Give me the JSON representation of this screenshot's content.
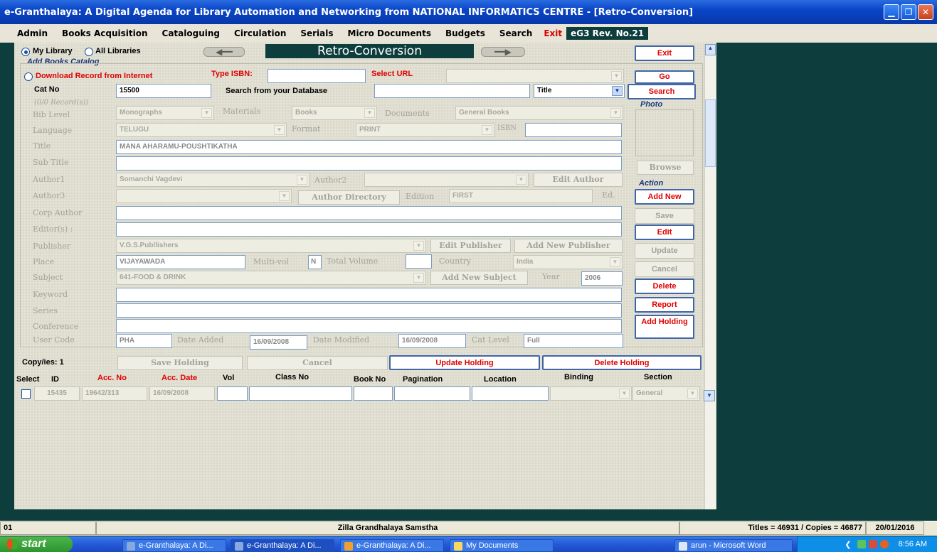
{
  "window": {
    "title": "e-Granthalaya: A Digital Agenda for Library Automation and Networking from NATIONAL INFORMATICS CENTRE - [Retro-Conversion]"
  },
  "menu": {
    "items": [
      "Admin",
      "Books Acquisition",
      "Cataloguing",
      "Circulation",
      "Serials",
      "Micro Documents",
      "Budgets",
      "Search"
    ],
    "exit": "Exit",
    "rev": "eG3 Rev. No.21"
  },
  "header": {
    "my_library": "My Library",
    "all_libraries": "All Libraries",
    "title": "Retro-Conversion",
    "exit": "Exit",
    "add_books": "Add Books Catalog",
    "download": "Download Record from Internet",
    "type_isbn": "Type ISBN:",
    "select_url": "Select URL",
    "go": "Go"
  },
  "form": {
    "cat_no_label": "Cat No",
    "cat_no": "15500",
    "search_db_label": "Search from your Database",
    "search_field": "Title",
    "search_btn": "Search",
    "record_count": "(0/0 Record(s))",
    "photo": "Photo",
    "bib_level_label": "Bib Level",
    "bib_level": "Monographs",
    "materials_label": "Materials",
    "materials": "Books",
    "documents_label": "Documents",
    "documents": "General Books",
    "language_label": "Language",
    "language": "TELUGU",
    "format_label": "Format",
    "format": "PRINT",
    "isbn_label": "ISBN",
    "isbn": "",
    "title_label": "Title",
    "title": "MANA AHARAMU-POUSHTIKATHA",
    "subtitle_label": "Sub Title",
    "subtitle": "",
    "author1_label": "Author1",
    "author1": "Somanchi Vagdevi",
    "author2_label": "Author2",
    "author2": "",
    "edit_author": "Edit Author",
    "browse": "Browse",
    "author3_label": "Author3",
    "author3": "",
    "author_directory": "Author Directory",
    "edition_label": "Edition",
    "edition": "FIRST",
    "ed_label": "Ed.",
    "corp_author_label": "Corp Author",
    "editors_label": "Editor(s) :",
    "publisher_label": "Publisher",
    "publisher": "V.G.S.Publlishers",
    "edit_publisher": "Edit Publisher",
    "add_publisher": "Add New Publisher",
    "place_label": "Place",
    "place": "VIJAYAWADA",
    "multivol_label": "Multi-vol",
    "multivol": "N",
    "total_volume_label": "Total Volume",
    "total_volume": "",
    "country_label": "Country",
    "country": "India",
    "subject_label": "Subject",
    "subject": "641-FOOD & DRINK",
    "add_subject": "Add New Subject",
    "year_label": "Year",
    "year": "2006",
    "keyword_label": "Keyword",
    "series_label": "Series",
    "conference_label": "Conference",
    "user_code_label": "User Code",
    "user_code": "PHA",
    "date_added_label": "Date Added",
    "date_added": "16/09/2008",
    "date_modified_label": "Date Modified",
    "date_modified": "16/09/2008",
    "cat_level_label": "Cat Level",
    "cat_level": "Full"
  },
  "actions": {
    "label": "Action",
    "add_new": "Add New",
    "save": "Save",
    "edit": "Edit",
    "update": "Update",
    "cancel": "Cancel",
    "delete": "Delete",
    "report": "Report",
    "add_holding": "Add Holding"
  },
  "holdings": {
    "copies": "Copy/ies: 1",
    "save_holding": "Save Holding",
    "cancel": "Cancel",
    "update_holding": "Update Holding",
    "delete_holding": "Delete Holding",
    "columns": {
      "select": "Select",
      "id": "ID",
      "acc_no": "Acc. No",
      "acc_date": "Acc. Date",
      "vol": "Vol",
      "class_no": "Class No",
      "book_no": "Book No",
      "pagination": "Pagination",
      "location": "Location",
      "binding": "Binding",
      "section": "Section"
    },
    "row": {
      "id": "15435",
      "acc_no": "19642/313",
      "acc_date": "16/09/2008",
      "vol": "",
      "class_no": "",
      "book_no": "",
      "pagination": "",
      "location": "",
      "binding": "",
      "section": "General"
    }
  },
  "status": {
    "left": "01",
    "center": "Zilla Grandhalaya Samstha",
    "titles": "Titles = 46931 / Copies = 46877",
    "date": "20/01/2016"
  },
  "taskbar": {
    "start": "start",
    "tasks": [
      "e-Granthalaya: A Di...",
      "e-Granthalaya: A Di...",
      "e-Granthalaya: A Di...",
      "My Documents",
      "arun - Microsoft Word"
    ],
    "time": "8:56 AM"
  }
}
